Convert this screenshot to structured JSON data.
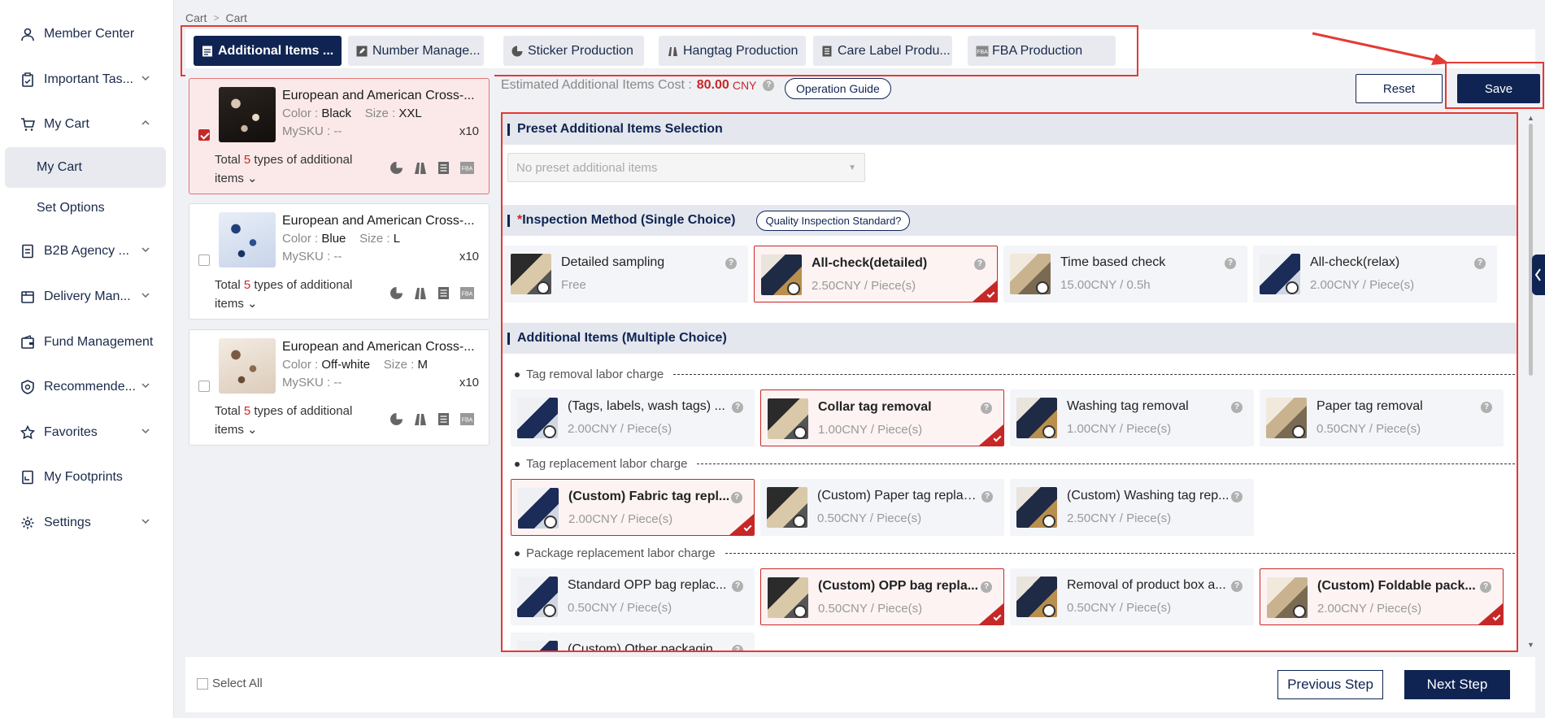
{
  "sidebar": {
    "items": [
      {
        "label": "Member Center",
        "icon": "user-icon"
      },
      {
        "label": "Important Tas...",
        "icon": "clipboard-icon"
      },
      {
        "label": "My Cart",
        "icon": "cart-icon"
      },
      {
        "label": "My Cart"
      },
      {
        "label": "Set Options"
      },
      {
        "label": "B2B Agency ...",
        "icon": "document-icon"
      },
      {
        "label": "Delivery Man...",
        "icon": "box-icon"
      },
      {
        "label": "Fund Management",
        "icon": "wallet-icon"
      },
      {
        "label": "Recommende...",
        "icon": "recommend-icon"
      },
      {
        "label": "Favorites",
        "icon": "star-icon"
      },
      {
        "label": "My Footprints",
        "icon": "footprint-icon"
      },
      {
        "label": "Settings",
        "icon": "gear-icon"
      }
    ]
  },
  "breadcrumb": [
    "Cart",
    "Cart"
  ],
  "tabs": [
    {
      "label": "Additional Items ..."
    },
    {
      "label": "Number Manage..."
    },
    {
      "label": "Sticker Production"
    },
    {
      "label": "Hangtag Production"
    },
    {
      "label": "Care Label Produ..."
    },
    {
      "label": "FBA Production"
    }
  ],
  "products": [
    {
      "title": "European and American Cross-...",
      "color_label": "Color : ",
      "color": "Black",
      "size_label": "Size : ",
      "size": "XXL",
      "sku": "MySKU : --",
      "qty": "x10",
      "total_pre": "Total ",
      "total_num": "5",
      "total_post": " types of additional items",
      "selected": true
    },
    {
      "title": "European and American Cross-...",
      "color_label": "Color : ",
      "color": "Blue",
      "size_label": "Size : ",
      "size": "L",
      "sku": "MySKU : --",
      "qty": "x10",
      "total_pre": "Total ",
      "total_num": "5",
      "total_post": " types of additional items",
      "selected": false
    },
    {
      "title": "European and American Cross-...",
      "color_label": "Color : ",
      "color": "Off-white",
      "size_label": "Size : ",
      "size": "M",
      "sku": "MySKU : --",
      "qty": "x10",
      "total_pre": "Total ",
      "total_num": "5",
      "total_post": " types of additional items",
      "selected": false
    }
  ],
  "estimate": {
    "label": "Estimated Additional Items Cost :",
    "value": "80.00",
    "currency": "CNY"
  },
  "operation_guide": "Operation Guide",
  "reset_label": "Reset",
  "save_label": "Save",
  "preset": {
    "title": "Preset Additional Items Selection",
    "placeholder": "No preset additional items"
  },
  "inspection": {
    "req": "*",
    "title": "Inspection Method (Single Choice)",
    "standard_btn": "Quality Inspection Standard?",
    "options": [
      {
        "name": "Detailed sampling",
        "price": "Free",
        "selected": false
      },
      {
        "name": "All-check(detailed)",
        "price": "2.50CNY / Piece(s)",
        "selected": true
      },
      {
        "name": "Time based check",
        "price": "15.00CNY / 0.5h",
        "selected": false
      },
      {
        "name": "All-check(relax)",
        "price": "2.00CNY / Piece(s)",
        "selected": false
      }
    ]
  },
  "additional": {
    "title": "Additional Items (Multiple Choice)",
    "groups": [
      {
        "label": "Tag removal labor charge",
        "options": [
          {
            "name": "(Tags, labels, wash tags) ...",
            "price": "2.00CNY / Piece(s)",
            "selected": false
          },
          {
            "name": "Collar tag removal",
            "price": "1.00CNY / Piece(s)",
            "selected": true
          },
          {
            "name": "Washing tag removal",
            "price": "1.00CNY / Piece(s)",
            "selected": false
          },
          {
            "name": "Paper tag removal",
            "price": "0.50CNY / Piece(s)",
            "selected": false
          }
        ]
      },
      {
        "label": "Tag replacement labor charge",
        "options": [
          {
            "name": "(Custom) Fabric tag repl...",
            "price": "2.00CNY / Piece(s)",
            "selected": true
          },
          {
            "name": "(Custom) Paper tag replac...",
            "price": "0.50CNY / Piece(s)",
            "selected": false
          },
          {
            "name": "(Custom) Washing tag rep...",
            "price": "2.50CNY / Piece(s)",
            "selected": false
          }
        ]
      },
      {
        "label": "Package replacement labor charge",
        "options": [
          {
            "name": "Standard OPP bag replac...",
            "price": "0.50CNY / Piece(s)",
            "selected": false
          },
          {
            "name": "(Custom) OPP bag repla...",
            "price": "0.50CNY / Piece(s)",
            "selected": true
          },
          {
            "name": "Removal of product box a...",
            "price": "0.50CNY / Piece(s)",
            "selected": false
          },
          {
            "name": "(Custom) Foldable pack...",
            "price": "2.00CNY / Piece(s)",
            "selected": true
          }
        ]
      },
      {
        "label": "",
        "options": [
          {
            "name": "(Custom) Other packaging...",
            "price": "",
            "selected": false
          }
        ]
      }
    ]
  },
  "bottom": {
    "select_all": "Select All",
    "prev": "Previous Step",
    "next": "Next Step"
  },
  "colors": {
    "navy": "#0f2452",
    "red": "#c62828",
    "highlight": "#e53935"
  }
}
